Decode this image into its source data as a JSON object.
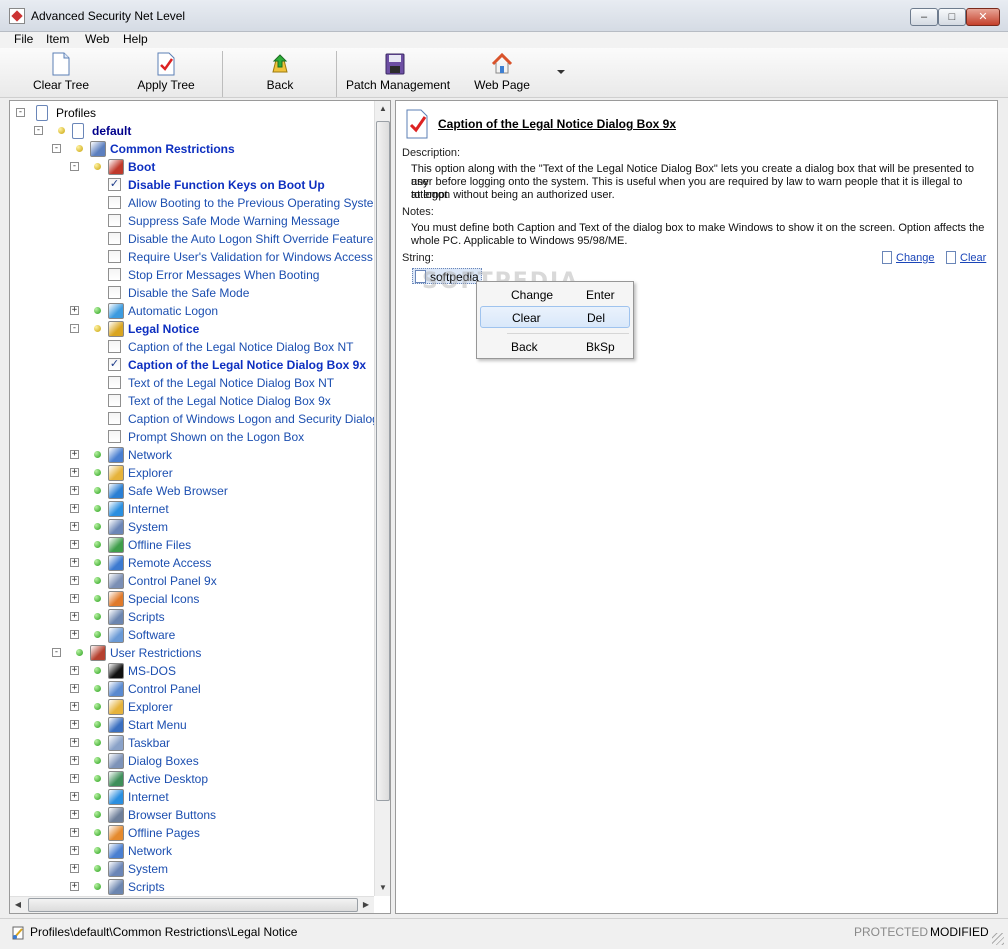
{
  "window": {
    "title": "Advanced Security Net Level",
    "controls": {
      "minimize": "–",
      "maximize": "□",
      "close": "✕"
    }
  },
  "menu": [
    "File",
    "Item",
    "Web",
    "Help"
  ],
  "toolbar": {
    "clear_tree": "Clear Tree",
    "apply_tree": "Apply Tree",
    "back": "Back",
    "patch_management": "Patch Management",
    "web_page": "Web Page"
  },
  "tree": {
    "rows": [
      {
        "label": "Profiles"
      },
      {
        "label": "default"
      },
      {
        "label": "Common Restrictions"
      },
      {
        "label": "Boot"
      },
      {
        "label": "Disable Function Keys on Boot Up",
        "checked": true
      },
      {
        "label": "Allow Booting to the Previous Operating System",
        "checked": false
      },
      {
        "label": "Suppress Safe Mode Warning Message",
        "checked": false
      },
      {
        "label": "Disable the Auto Logon Shift Override Feature",
        "checked": false
      },
      {
        "label": "Require User's Validation for Windows Access",
        "checked": false
      },
      {
        "label": "Stop Error Messages When Booting",
        "checked": false
      },
      {
        "label": "Disable the Safe Mode",
        "checked": false
      },
      {
        "label": "Automatic Logon"
      },
      {
        "label": "Legal Notice"
      },
      {
        "label": "Caption of the Legal Notice Dialog Box NT",
        "checked": false
      },
      {
        "label": "Caption of the Legal Notice Dialog Box 9x",
        "checked": true
      },
      {
        "label": "Text of the Legal Notice Dialog Box NT",
        "checked": false
      },
      {
        "label": "Text of the Legal Notice Dialog Box 9x",
        "checked": false
      },
      {
        "label": "Caption of Windows Logon and Security Dialog",
        "checked": false
      },
      {
        "label": "Prompt Shown on the Logon Box",
        "checked": false
      },
      {
        "label": "Network"
      },
      {
        "label": "Explorer"
      },
      {
        "label": "Safe Web Browser"
      },
      {
        "label": "Internet"
      },
      {
        "label": "System"
      },
      {
        "label": "Offline Files"
      },
      {
        "label": "Remote Access"
      },
      {
        "label": "Control Panel 9x"
      },
      {
        "label": "Special Icons"
      },
      {
        "label": "Scripts"
      },
      {
        "label": "Software"
      },
      {
        "label": "User Restrictions"
      },
      {
        "label": "MS-DOS"
      },
      {
        "label": "Control Panel"
      },
      {
        "label": "Explorer"
      },
      {
        "label": "Start Menu"
      },
      {
        "label": "Taskbar"
      },
      {
        "label": "Dialog Boxes"
      },
      {
        "label": "Active Desktop"
      },
      {
        "label": "Internet"
      },
      {
        "label": "Browser Buttons"
      },
      {
        "label": "Offline Pages"
      },
      {
        "label": "Network"
      },
      {
        "label": "System"
      },
      {
        "label": "Scripts"
      }
    ]
  },
  "detail": {
    "title": "Caption of the Legal Notice Dialog Box 9x",
    "description_label": "Description:",
    "description_line1": "This option along with the \"Text of the Legal Notice Dialog Box\" lets you create a dialog box that will be presented to any",
    "description_line2": "user before logging onto the system. This is useful when you are required by law to warn people that it is illegal to attempt",
    "description_line3": "to logon without being an authorized user.",
    "notes_label": "Notes:",
    "notes_line1": "You must define both Caption and Text of the dialog box to make Windows to show it on the screen. Option affects the",
    "notes_line2": "whole PC. Applicable to Windows 95/98/ME.",
    "string_label": "String:",
    "change_link": "Change",
    "clear_link": "Clear",
    "string_value": "softpedia",
    "watermark": "SOFTPEDIA"
  },
  "context_menu": [
    {
      "label": "Change",
      "key": "Enter"
    },
    {
      "label": "Clear",
      "key": "Del"
    },
    {
      "label": "Back",
      "key": "BkSp"
    }
  ],
  "status": {
    "path": "Profiles\\default\\Common Restrictions\\Legal Notice",
    "protected": "PROTECTED",
    "modified": "MODIFIED"
  }
}
